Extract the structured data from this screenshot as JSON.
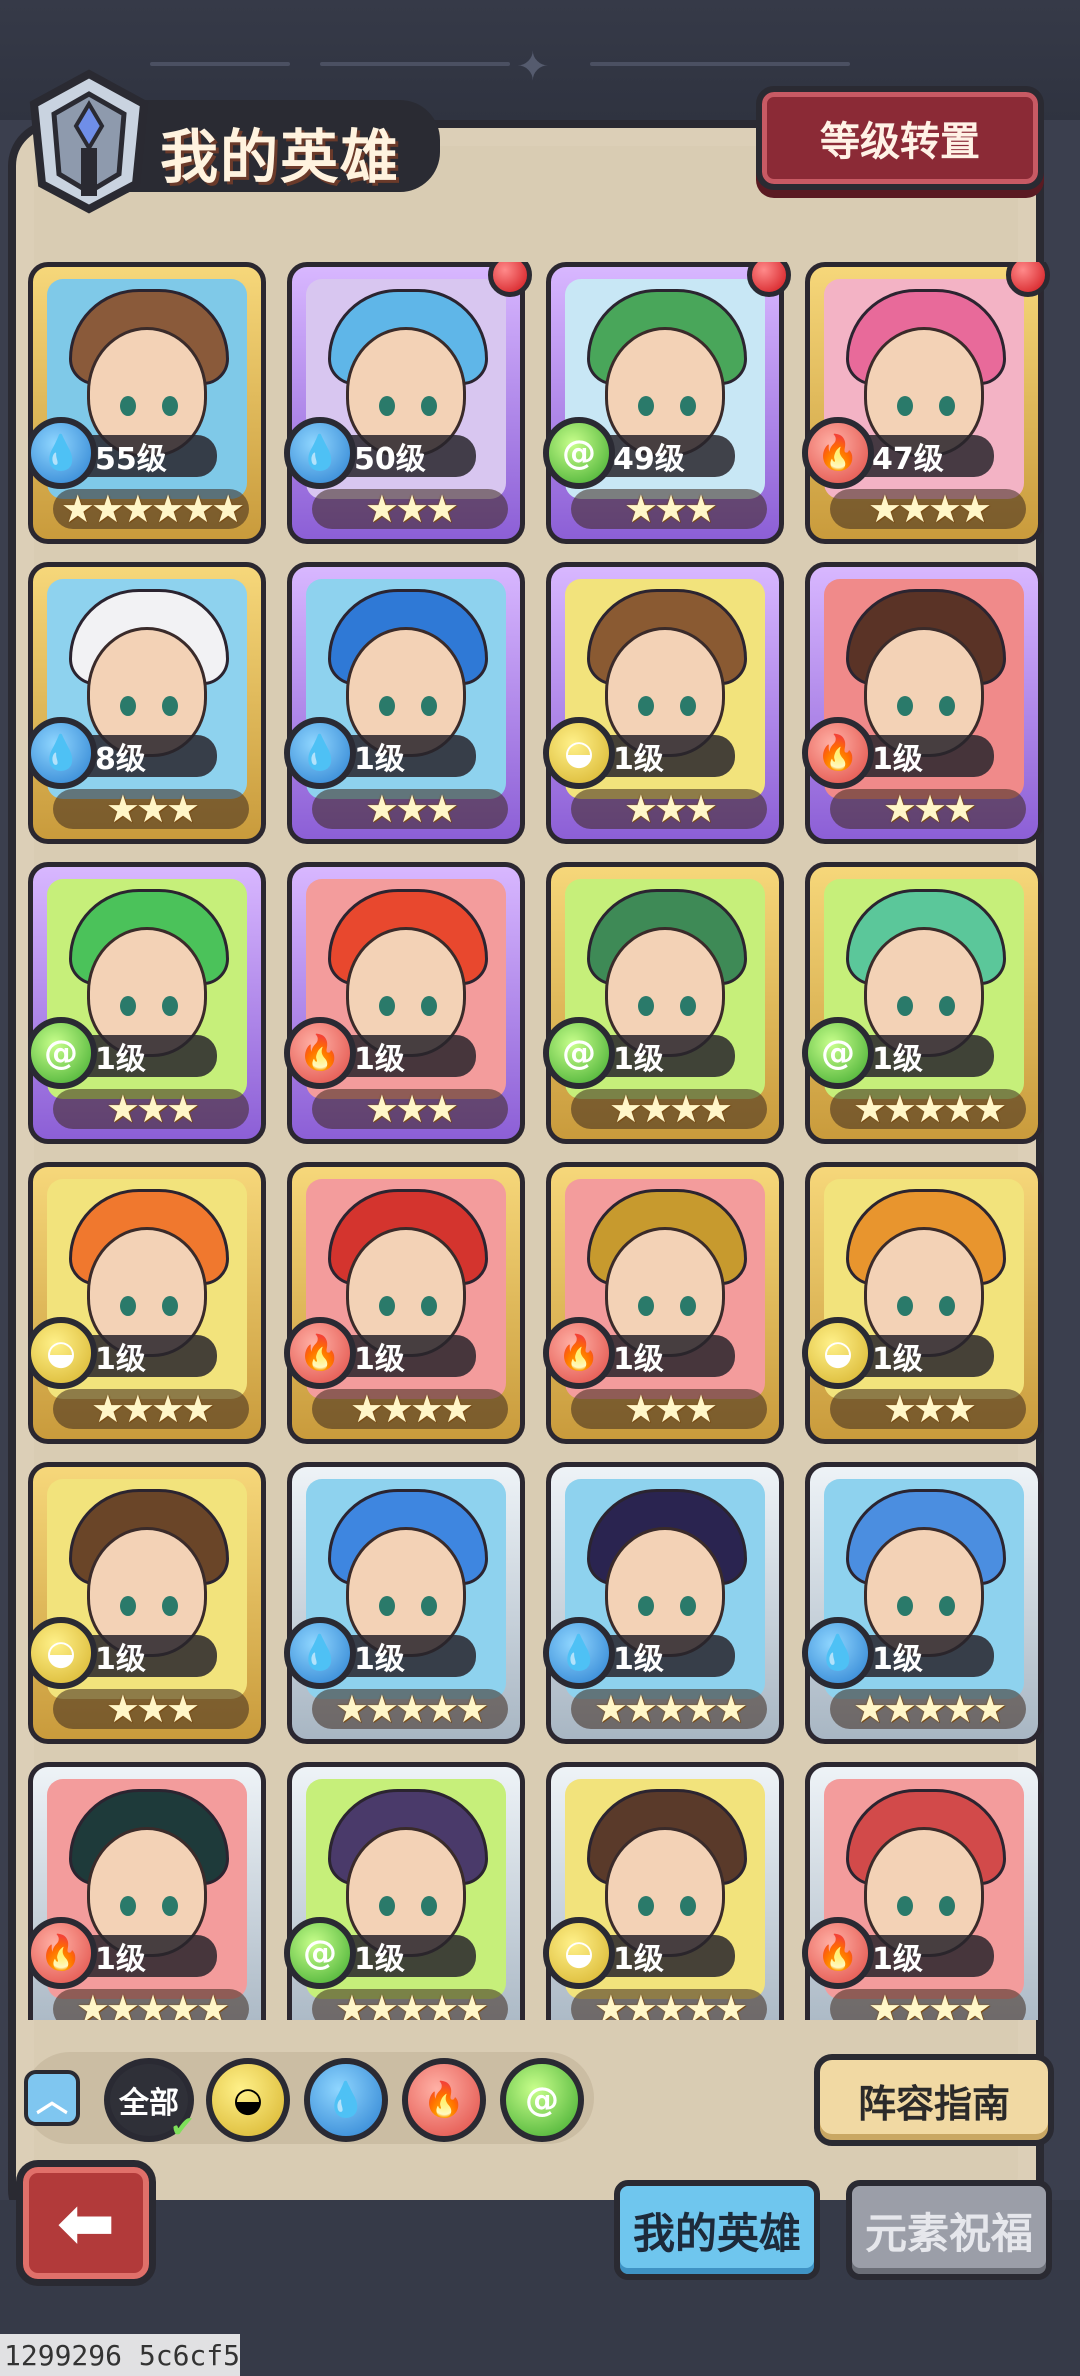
{
  "header": {
    "title": "我的英雄",
    "level_transfer_button": "等级转置"
  },
  "heroes": [
    {
      "level": "55级",
      "element": "water",
      "stars": "★★★★★★",
      "frame": "gold",
      "hair": "#8a5a3a",
      "bg": "#7fc9e8",
      "new": false
    },
    {
      "level": "50级",
      "element": "water",
      "stars": "★★★",
      "frame": "purple",
      "hair": "#5fb6e8",
      "bg": "#d8c6f0",
      "new": true
    },
    {
      "level": "49级",
      "element": "wind",
      "stars": "★★★",
      "frame": "purple",
      "hair": "#49a65a",
      "bg": "#c8e7f5",
      "new": true
    },
    {
      "level": "47级",
      "element": "fire",
      "stars": "★★★★",
      "frame": "gold",
      "hair": "#e86a9a",
      "bg": "#f3b3c5",
      "new": true
    },
    {
      "level": "8级",
      "element": "water",
      "stars": "★★★",
      "frame": "gold",
      "hair": "#f2f2f4",
      "bg": "#8ed2ee",
      "new": false
    },
    {
      "level": "1级",
      "element": "water",
      "stars": "★★★",
      "frame": "purple",
      "hair": "#2f79d6",
      "bg": "#8ed2ee",
      "new": false
    },
    {
      "level": "1级",
      "element": "earth",
      "stars": "★★★",
      "frame": "purple",
      "hair": "#8a5a32",
      "bg": "#f2e37c",
      "new": false
    },
    {
      "level": "1级",
      "element": "fire",
      "stars": "★★★",
      "frame": "purple",
      "hair": "#5a3326",
      "bg": "#f08a8a",
      "new": false
    },
    {
      "level": "1级",
      "element": "wind",
      "stars": "★★★",
      "frame": "purple",
      "hair": "#4bc25a",
      "bg": "#c6ef7a",
      "new": false
    },
    {
      "level": "1级",
      "element": "fire",
      "stars": "★★★",
      "frame": "purple",
      "hair": "#e8482e",
      "bg": "#f39c9c",
      "new": false
    },
    {
      "level": "1级",
      "element": "wind",
      "stars": "★★★★",
      "frame": "gold",
      "hair": "#3e8a56",
      "bg": "#c6ef7a",
      "new": false
    },
    {
      "level": "1级",
      "element": "wind",
      "stars": "★★★★★",
      "frame": "gold",
      "hair": "#5bc79a",
      "bg": "#c6ef7a",
      "new": false
    },
    {
      "level": "1级",
      "element": "earth",
      "stars": "★★★★",
      "frame": "gold",
      "hair": "#f0782e",
      "bg": "#f2e37c",
      "new": false
    },
    {
      "level": "1级",
      "element": "fire",
      "stars": "★★★★",
      "frame": "gold",
      "hair": "#d4342e",
      "bg": "#f39c9c",
      "new": false
    },
    {
      "level": "1级",
      "element": "fire",
      "stars": "★★★",
      "frame": "gold",
      "hair": "#c79a2e",
      "bg": "#f39c9c",
      "new": false
    },
    {
      "level": "1级",
      "element": "earth",
      "stars": "★★★",
      "frame": "gold",
      "hair": "#e8952e",
      "bg": "#f2e37c",
      "new": false
    },
    {
      "level": "1级",
      "element": "earth",
      "stars": "★★★",
      "frame": "gold",
      "hair": "#6a4528",
      "bg": "#f2e37c",
      "new": false
    },
    {
      "level": "1级",
      "element": "water",
      "stars": "★★★★★",
      "frame": "silver",
      "hair": "#3e86e0",
      "bg": "#8ed2ee",
      "new": false
    },
    {
      "level": "1级",
      "element": "water",
      "stars": "★★★★★",
      "frame": "silver",
      "hair": "#2a2450",
      "bg": "#8ed2ee",
      "new": false
    },
    {
      "level": "1级",
      "element": "water",
      "stars": "★★★★★",
      "frame": "silver",
      "hair": "#4b8ee0",
      "bg": "#8ed2ee",
      "new": false
    },
    {
      "level": "1级",
      "element": "fire",
      "stars": "★★★★★",
      "frame": "silver",
      "hair": "#1e3a3a",
      "bg": "#f39c9c",
      "new": false
    },
    {
      "level": "1级",
      "element": "wind",
      "stars": "★★★★★",
      "frame": "silver",
      "hair": "#4a3a6a",
      "bg": "#c6ef7a",
      "new": false
    },
    {
      "level": "1级",
      "element": "earth",
      "stars": "★★★★★",
      "frame": "silver",
      "hair": "#5a3a2a",
      "bg": "#f2e37c",
      "new": false
    },
    {
      "level": "1级",
      "element": "fire",
      "stars": "★★★★",
      "frame": "silver",
      "hair": "#d24a4a",
      "bg": "#f39c9c",
      "new": false
    }
  ],
  "filters": {
    "all_label": "全部",
    "elements": [
      "earth",
      "water",
      "fire",
      "wind"
    ],
    "expand_icon": "chevron-up-icon"
  },
  "guide_button": "阵容指南",
  "tabs": {
    "my_heroes": "我的英雄",
    "element_blessing": "元素祝福"
  },
  "back_icon": "arrow-left-icon",
  "watermark": "1299296 5c6cf5",
  "element_colors": {
    "water": "#2a7fd0",
    "wind": "#3ca82c",
    "fire": "#e04a43",
    "earth": "#d6b22b"
  }
}
